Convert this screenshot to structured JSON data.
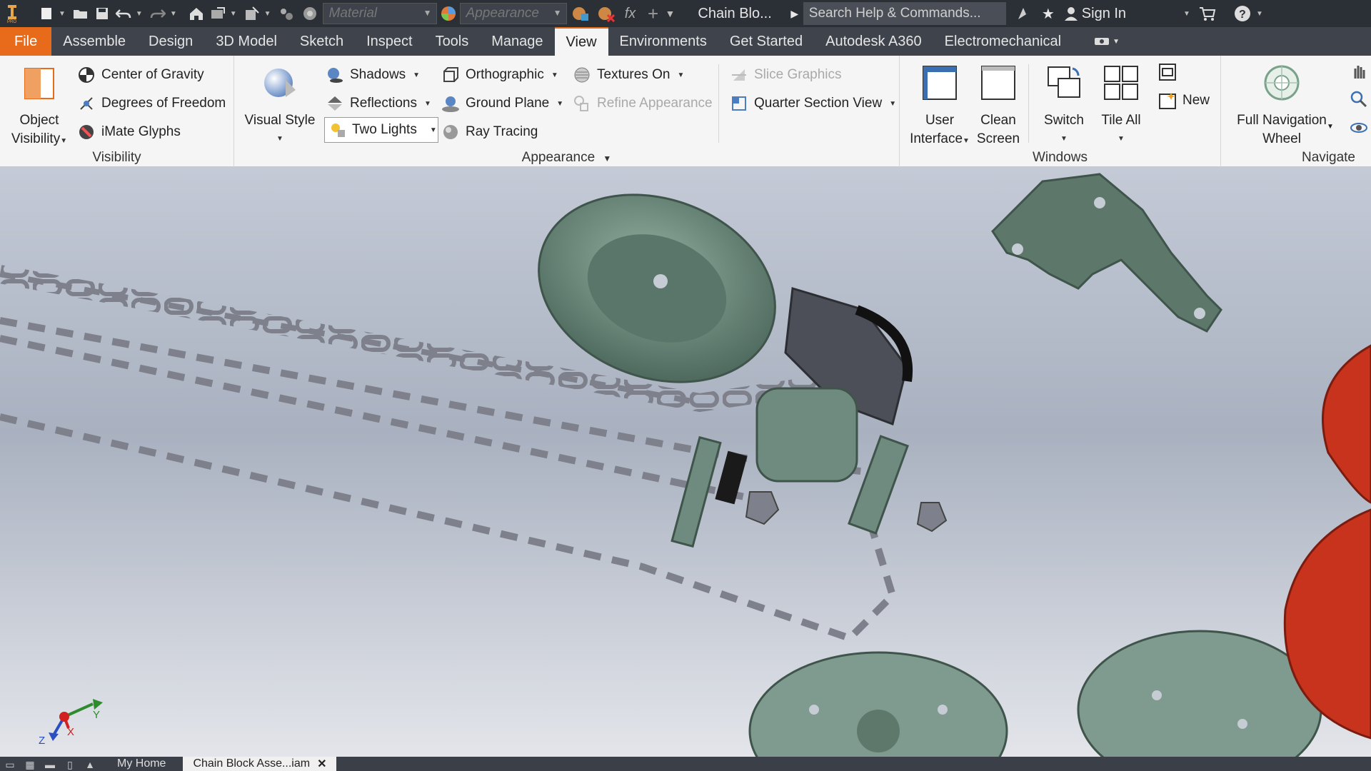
{
  "qat": {
    "material_placeholder": "Material",
    "appearance_placeholder": "Appearance",
    "fx_label": "fx",
    "document_name": "Chain Blo...",
    "search_placeholder": "Search Help & Commands...",
    "sign_in": "Sign In"
  },
  "tabs": [
    {
      "label": "File"
    },
    {
      "label": "Assemble"
    },
    {
      "label": "Design"
    },
    {
      "label": "3D Model"
    },
    {
      "label": "Sketch"
    },
    {
      "label": "Inspect"
    },
    {
      "label": "Tools"
    },
    {
      "label": "Manage"
    },
    {
      "label": "View"
    },
    {
      "label": "Environments"
    },
    {
      "label": "Get Started"
    },
    {
      "label": "Autodesk A360"
    },
    {
      "label": "Electromechanical"
    }
  ],
  "ribbon": {
    "visibility": {
      "title": "Visibility",
      "object_visibility": [
        "Object",
        "Visibility"
      ],
      "center_of_gravity": "Center of Gravity",
      "degrees_of_freedom": "Degrees of Freedom",
      "imate_glyphs": "iMate Glyphs"
    },
    "appearance": {
      "title": "Appearance",
      "visual_style": "Visual Style",
      "shadows": "Shadows",
      "reflections": "Reflections",
      "lighting": "Two Lights",
      "orthographic": "Orthographic",
      "ground_plane": "Ground Plane",
      "ray_tracing": "Ray Tracing",
      "textures_on": "Textures On",
      "refine_appearance": "Refine Appearance",
      "slice_graphics": "Slice Graphics",
      "quarter_section_view": "Quarter Section View"
    },
    "windows": {
      "title": "Windows",
      "user_interface": [
        "User",
        "Interface"
      ],
      "clean_screen": [
        "Clean",
        "Screen"
      ],
      "switch": "Switch",
      "tile_all": "Tile All",
      "new": "New"
    },
    "navigate": {
      "title": "Navigate",
      "full_navigation_wheel": [
        "Full Navigation",
        "Wheel"
      ]
    }
  },
  "viewcube_axes": {
    "x": "X",
    "y": "Y",
    "z": "Z"
  },
  "status": {
    "tabs": [
      {
        "label": "My Home"
      },
      {
        "label": "Chain Block Asse...iam"
      }
    ]
  },
  "colors": {
    "accent": "#e86b1c",
    "model_green": "#6f8a7e",
    "chain_gray": "#8a8d96",
    "hook_red": "#c8331e"
  }
}
